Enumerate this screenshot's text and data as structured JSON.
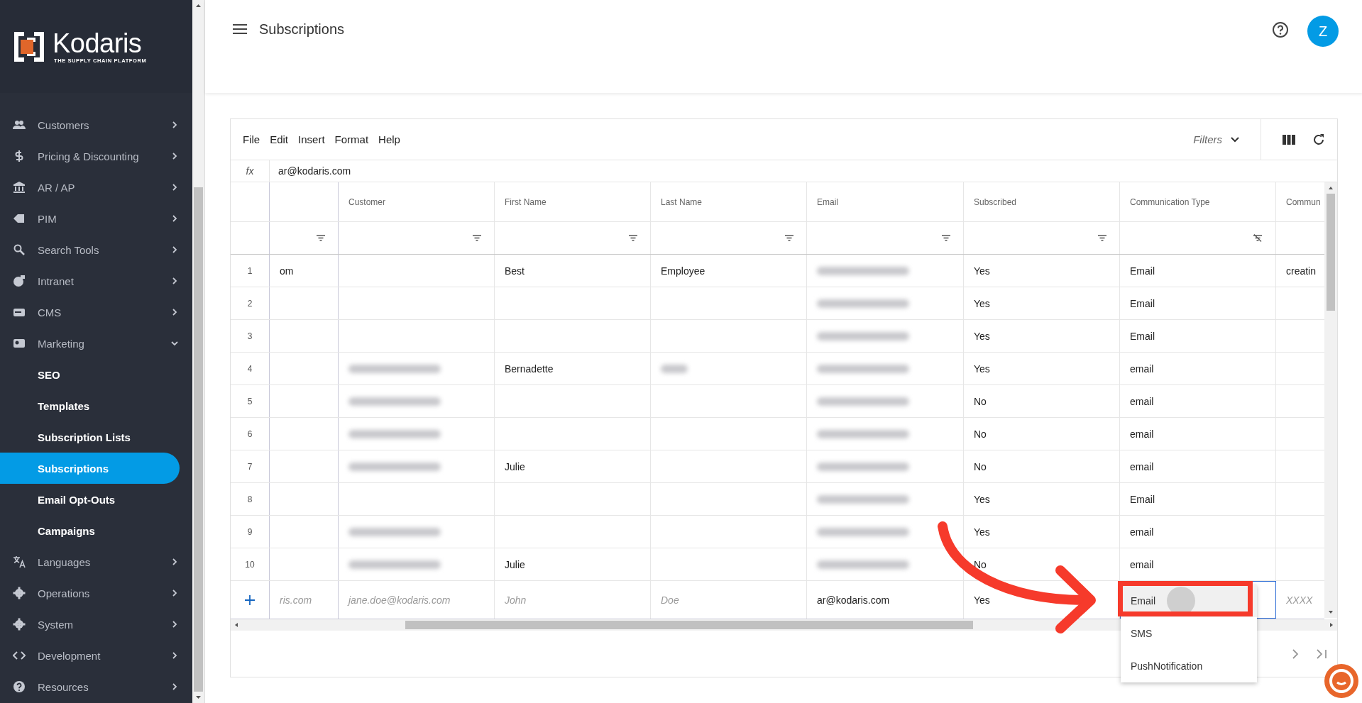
{
  "brand": {
    "name": "Kodaris",
    "tagline": "THE SUPPLY CHAIN PLATFORM"
  },
  "sidebar": {
    "items": [
      {
        "label": "Customers",
        "expanded": false
      },
      {
        "label": "Pricing & Discounting",
        "expanded": false
      },
      {
        "label": "AR / AP",
        "expanded": false
      },
      {
        "label": "PIM",
        "expanded": false
      },
      {
        "label": "Search Tools",
        "expanded": false
      },
      {
        "label": "Intranet",
        "expanded": false
      },
      {
        "label": "CMS",
        "expanded": false
      },
      {
        "label": "Marketing",
        "expanded": true,
        "children": [
          {
            "label": "SEO",
            "selected": false
          },
          {
            "label": "Templates",
            "selected": false
          },
          {
            "label": "Subscription Lists",
            "selected": false
          },
          {
            "label": "Subscriptions",
            "selected": true
          },
          {
            "label": "Email Opt-Outs",
            "selected": false
          },
          {
            "label": "Campaigns",
            "selected": false
          }
        ]
      },
      {
        "label": "Languages",
        "expanded": false
      },
      {
        "label": "Operations",
        "expanded": false
      },
      {
        "label": "System",
        "expanded": false
      },
      {
        "label": "Development",
        "expanded": false
      },
      {
        "label": "Resources",
        "expanded": false
      }
    ]
  },
  "header": {
    "title": "Subscriptions",
    "avatar": "Z"
  },
  "toolbar": {
    "menus": [
      "File",
      "Edit",
      "Insert",
      "Format",
      "Help"
    ],
    "filters": "Filters"
  },
  "formula_bar": {
    "label": "fx",
    "value": "ar@kodaris.com"
  },
  "table": {
    "columns": [
      {
        "filtered": false
      },
      {
        "label": "Customer",
        "filtered": false
      },
      {
        "label": "First Name",
        "filtered": false
      },
      {
        "label": "Last Name",
        "filtered": false
      },
      {
        "label": "Email",
        "filtered": false
      },
      {
        "label": "Subscribed",
        "filtered": false
      },
      {
        "label": "Communication Type",
        "filtered": true
      },
      {
        "label": "Commun"
      }
    ],
    "rows": [
      {
        "number": "1",
        "cells": [
          {
            "kind": "text",
            "text": "om"
          },
          {
            "kind": "empty"
          },
          {
            "kind": "text",
            "text": "Best"
          },
          {
            "kind": "text",
            "text": "Employee"
          },
          {
            "kind": "blurred"
          },
          {
            "kind": "text",
            "text": "Yes"
          },
          {
            "kind": "text",
            "text": "Email"
          },
          {
            "kind": "text",
            "text": "creatin"
          }
        ]
      },
      {
        "number": "2",
        "cells": [
          {
            "kind": "empty"
          },
          {
            "kind": "empty"
          },
          {
            "kind": "empty"
          },
          {
            "kind": "empty"
          },
          {
            "kind": "blurred"
          },
          {
            "kind": "text",
            "text": "Yes"
          },
          {
            "kind": "text",
            "text": "Email"
          },
          {
            "kind": "empty"
          }
        ]
      },
      {
        "number": "3",
        "cells": [
          {
            "kind": "empty"
          },
          {
            "kind": "empty"
          },
          {
            "kind": "empty"
          },
          {
            "kind": "empty"
          },
          {
            "kind": "blurred"
          },
          {
            "kind": "text",
            "text": "Yes"
          },
          {
            "kind": "text",
            "text": "Email"
          },
          {
            "kind": "empty"
          }
        ]
      },
      {
        "number": "4",
        "cells": [
          {
            "kind": "empty"
          },
          {
            "kind": "blurred"
          },
          {
            "kind": "text",
            "text": "Bernadette"
          },
          {
            "kind": "blurred"
          },
          {
            "kind": "blurred"
          },
          {
            "kind": "text",
            "text": "Yes"
          },
          {
            "kind": "text",
            "text": "email"
          },
          {
            "kind": "empty"
          }
        ]
      },
      {
        "number": "5",
        "cells": [
          {
            "kind": "empty"
          },
          {
            "kind": "blurred"
          },
          {
            "kind": "empty"
          },
          {
            "kind": "empty"
          },
          {
            "kind": "blurred"
          },
          {
            "kind": "text",
            "text": "No"
          },
          {
            "kind": "text",
            "text": "email"
          },
          {
            "kind": "empty"
          }
        ]
      },
      {
        "number": "6",
        "cells": [
          {
            "kind": "empty"
          },
          {
            "kind": "blurred"
          },
          {
            "kind": "empty"
          },
          {
            "kind": "empty"
          },
          {
            "kind": "blurred"
          },
          {
            "kind": "text",
            "text": "No"
          },
          {
            "kind": "text",
            "text": "email"
          },
          {
            "kind": "empty"
          }
        ]
      },
      {
        "number": "7",
        "cells": [
          {
            "kind": "empty"
          },
          {
            "kind": "blurred"
          },
          {
            "kind": "text",
            "text": "Julie"
          },
          {
            "kind": "empty"
          },
          {
            "kind": "blurred"
          },
          {
            "kind": "text",
            "text": "No"
          },
          {
            "kind": "text",
            "text": "email"
          },
          {
            "kind": "empty"
          }
        ]
      },
      {
        "number": "8",
        "cells": [
          {
            "kind": "empty"
          },
          {
            "kind": "empty"
          },
          {
            "kind": "empty"
          },
          {
            "kind": "empty"
          },
          {
            "kind": "blurred"
          },
          {
            "kind": "text",
            "text": "Yes"
          },
          {
            "kind": "text",
            "text": "Email"
          },
          {
            "kind": "empty"
          }
        ]
      },
      {
        "number": "9",
        "cells": [
          {
            "kind": "empty"
          },
          {
            "kind": "blurred"
          },
          {
            "kind": "empty"
          },
          {
            "kind": "empty"
          },
          {
            "kind": "blurred"
          },
          {
            "kind": "text",
            "text": "Yes"
          },
          {
            "kind": "text",
            "text": "email"
          },
          {
            "kind": "empty"
          }
        ]
      },
      {
        "number": "10",
        "cells": [
          {
            "kind": "empty"
          },
          {
            "kind": "blurred"
          },
          {
            "kind": "text",
            "text": "Julie"
          },
          {
            "kind": "empty"
          },
          {
            "kind": "blurred"
          },
          {
            "kind": "text",
            "text": "No"
          },
          {
            "kind": "text",
            "text": "email"
          },
          {
            "kind": "empty"
          }
        ]
      }
    ],
    "new_row": {
      "cells": [
        {
          "kind": "placeholder",
          "text": "ris.com"
        },
        {
          "kind": "placeholder",
          "text": "jane.doe@kodaris.com"
        },
        {
          "kind": "placeholder",
          "text": "John"
        },
        {
          "kind": "placeholder",
          "text": "Doe"
        },
        {
          "kind": "value",
          "text": "ar@kodaris.com"
        },
        {
          "kind": "value",
          "text": "Yes"
        },
        {
          "kind": "editor"
        },
        {
          "kind": "placeholder",
          "text": "XXXX"
        }
      ]
    },
    "dropdown": {
      "options": [
        {
          "label": "Email",
          "selected": true
        },
        {
          "label": "SMS",
          "selected": false
        },
        {
          "label": "PushNotification",
          "selected": false
        }
      ]
    }
  }
}
